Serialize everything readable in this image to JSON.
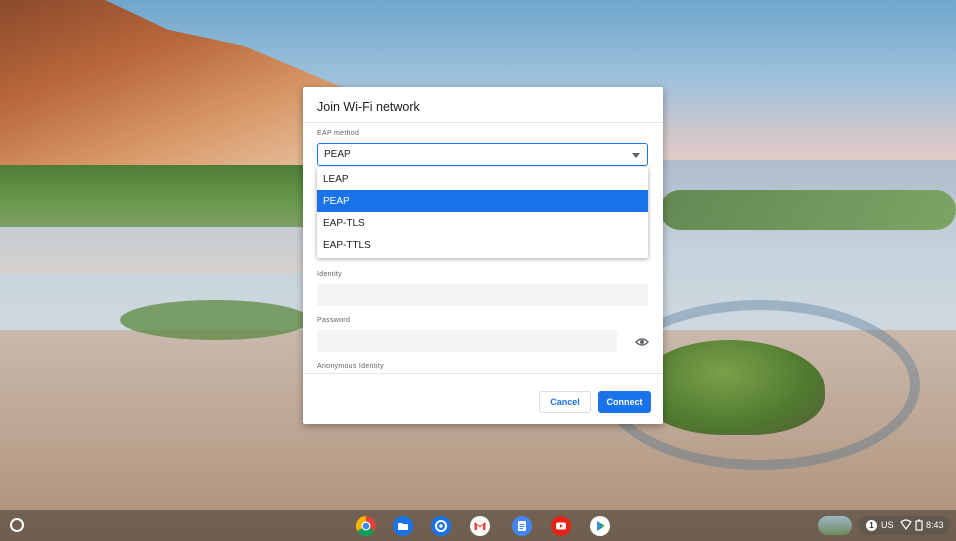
{
  "dialog": {
    "title": "Join Wi-Fi network",
    "eap_label": "EAP method",
    "eap_value": "PEAP",
    "eap_options": [
      "LEAP",
      "PEAP",
      "EAP-TLS",
      "EAP-TTLS"
    ],
    "selected_option": "PEAP",
    "identity_label": "Identity",
    "identity_value": "",
    "password_label": "Password",
    "password_value": "",
    "anonymous_identity_label": "Anonymous Identity",
    "cancel_label": "Cancel",
    "connect_label": "Connect"
  },
  "shelf": {
    "apps": [
      "chrome-icon",
      "files-icon",
      "app-icon",
      "gmail-icon",
      "docs-icon",
      "youtube-icon",
      "play-store-icon"
    ],
    "notification_count": "1",
    "keyboard_layout": "US",
    "time": "8:43"
  },
  "colors": {
    "accent": "#1a73e8",
    "shelf": "#3c372d"
  }
}
